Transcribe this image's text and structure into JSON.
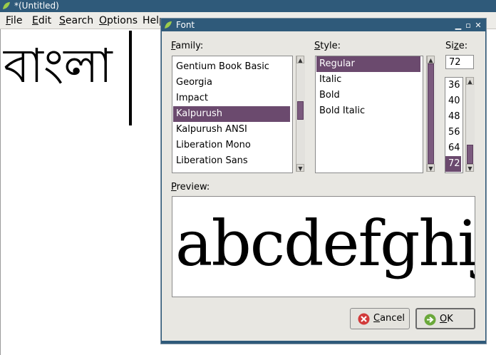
{
  "window": {
    "title": "*(Untitled)",
    "menu": [
      {
        "label": "File",
        "mnemonic": "F",
        "rest": "ile"
      },
      {
        "label": "Edit",
        "mnemonic": "E",
        "rest": "dit"
      },
      {
        "label": "Search",
        "mnemonic": "S",
        "rest": "earch"
      },
      {
        "label": "Options",
        "mnemonic": "O",
        "rest": "ptions"
      },
      {
        "label": "Help",
        "mnemonic": "",
        "rest": "Help"
      }
    ],
    "editor_text": "বাংলা"
  },
  "dialog": {
    "title": "Font",
    "controls": [
      "minimize",
      "maximize",
      "close"
    ],
    "family_label": {
      "mnemonic": "F",
      "rest": "amily:"
    },
    "style_label": {
      "mnemonic": "S",
      "rest": "tyle:"
    },
    "size_label": {
      "mnemonic": "z",
      "pre": "Si",
      "rest": "e:"
    },
    "families": [
      "Gentium Book Basic",
      "Georgia",
      "Impact",
      "Kalpurush",
      "Kalpurush ANSI",
      "Liberation Mono",
      "Liberation Sans"
    ],
    "selected_family": "Kalpurush",
    "styles": [
      "Regular",
      "Italic",
      "Bold",
      "Bold Italic"
    ],
    "selected_style": "Regular",
    "size_value": "72",
    "sizes": [
      "36",
      "40",
      "48",
      "56",
      "64",
      "72"
    ],
    "selected_size": "72",
    "preview_label": {
      "mnemonic": "P",
      "rest": "review:"
    },
    "preview_text": "abcdefghijk",
    "cancel_button": {
      "mnemonic": "C",
      "rest": "ancel"
    },
    "ok_button": {
      "mnemonic": "O",
      "rest": "K"
    },
    "colors": {
      "selection": "#6b4a6e",
      "titlebar": "#2f5a7a",
      "cancel_icon": "#d23a3a",
      "ok_icon": "#6aa83a"
    }
  }
}
